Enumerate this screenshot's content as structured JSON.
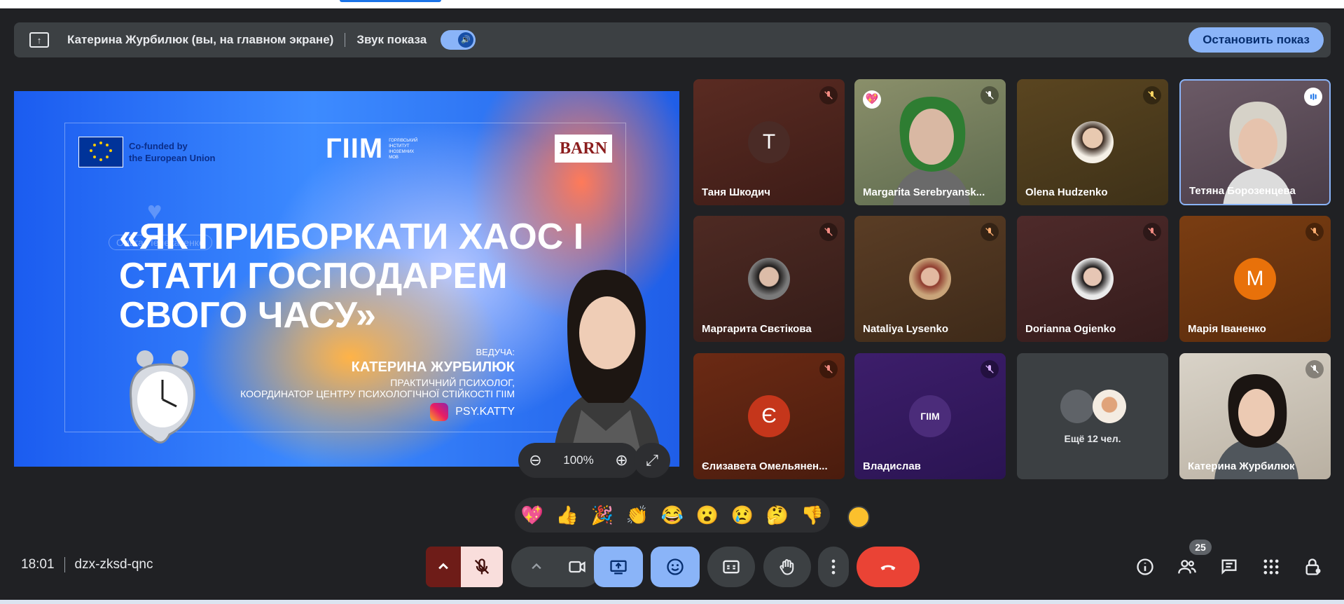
{
  "presenting_bar": {
    "presenter_label": "Катерина Журбилюк (вы, на главном экране)",
    "sound_label": "Звук показа",
    "stop_button": "Остановить показ"
  },
  "slide": {
    "eu_text_1": "Co-funded by",
    "eu_text_2": "the European Union",
    "giim_logo": "ГІІМ",
    "giim_subtext": "ГОРЛІВСЬКИЙ ІНСТИТУТ ІНОЗЕМНИХ МОВ",
    "barn_logo": "BARN",
    "title": "«ЯК ПРИБОРКАТИ ХАОС І СТАТИ ГОСПОДАРЕМ СВОГО ЧАСУ»",
    "host_label": "ВЕДУЧА:",
    "host_name": "КАТЕРИНА ЖУРБИЛЮК",
    "host_role_1": "ПРАКТИЧНИЙ ПСИХОЛОГ,",
    "host_role_2": "КООРДИНАТОР ЦЕНТРУ ПСИХОЛОГІЧНОЇ СТІЙКОСТІ ГІІМ",
    "instagram": "PSY.KATTY",
    "ghost_name": "Ольга Пелехатенко"
  },
  "zoom": {
    "level": "100%"
  },
  "tiles": [
    {
      "name": "Таня Шкодич",
      "letter": "T",
      "muted": true
    },
    {
      "name": "Margarita Serebryansk...",
      "muted": true
    },
    {
      "name": "Olena Hudzenko",
      "muted": true
    },
    {
      "name": "Тетяна Борозенцева",
      "speaking": true
    },
    {
      "name": "Маргарита Свєтікова",
      "muted": true
    },
    {
      "name": "Nataliya Lysenko",
      "muted": true
    },
    {
      "name": "Dorianna Ogienko",
      "muted": true
    },
    {
      "name": "Марія Іваненко",
      "letter": "M",
      "muted": true
    },
    {
      "name": "Єлизавета Омельянен...",
      "letter": "Є",
      "muted": true
    },
    {
      "name": "Владислав",
      "muted": true
    },
    {
      "name": "Ещё 12 чел."
    },
    {
      "name": "Катерина Журбилюк",
      "muted": true
    }
  ],
  "reactions": [
    "💖",
    "👍",
    "🎉",
    "👏",
    "😂",
    "😮",
    "😢",
    "🤔",
    "👎"
  ],
  "meeting": {
    "time": "18:01",
    "code": "dzx-zksd-qnc"
  },
  "participants_count": "25",
  "colors": {
    "accent": "#8ab4f8",
    "end_call": "#ea4335",
    "mic_off": "#f9dedc",
    "bg": "#202124"
  }
}
